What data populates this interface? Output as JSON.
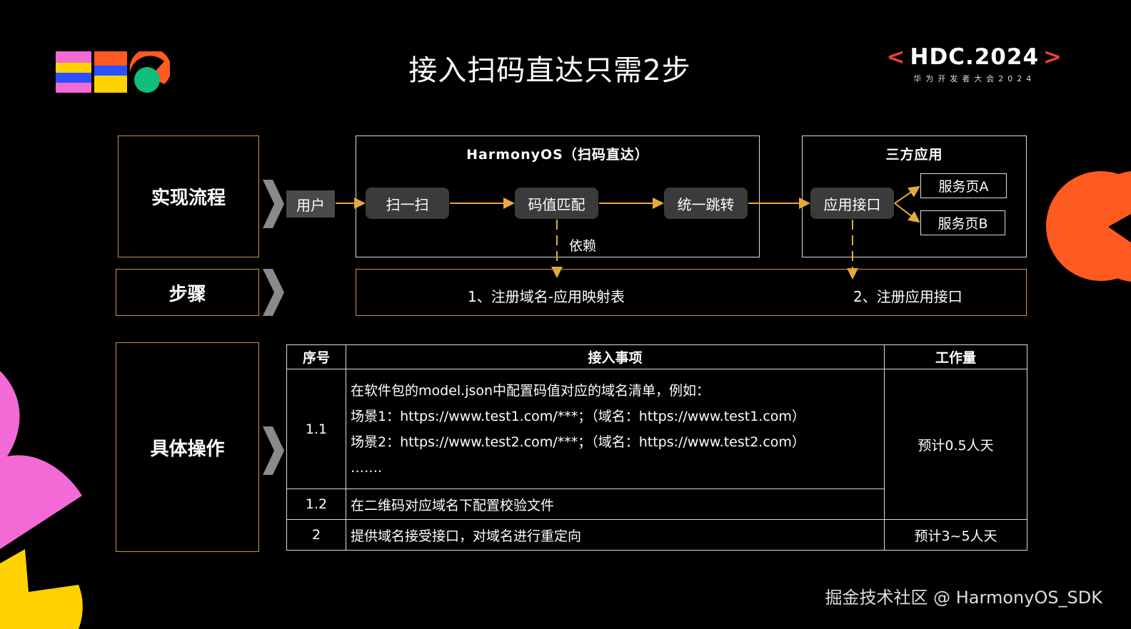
{
  "header": {
    "title": "接入扫码直达只需2步",
    "brand_main": "HDC.2024",
    "brand_lt": "<",
    "brand_gt": ">",
    "brand_sub": "华为开发者大会2024"
  },
  "rows": {
    "flow_label": "实现流程",
    "steps_label": "步骤",
    "ops_label": "具体操作"
  },
  "flow": {
    "user": "用户",
    "harmony_title": "HarmonyOS（扫码直达）",
    "scan": "扫一扫",
    "match": "码值匹配",
    "jump": "统一跳转",
    "depends": "依赖",
    "third_title": "三方应用",
    "app_api": "应用接口",
    "page_a": "服务页A",
    "page_b": "服务页B"
  },
  "steps": {
    "step1": "1、注册域名-应用映射表",
    "step2": "2、注册应用接口"
  },
  "table": {
    "headers": [
      "序号",
      "接入事项",
      "工作量"
    ],
    "rows": [
      {
        "no": "1.1",
        "lines": [
          "在软件包的model.json中配置码值对应的域名清单，例如：",
          "场景1：https://www.test1.com/***；（域名：https://www.test1.com）",
          "场景2：https://www.test2.com/***；（域名：https://www.test2.com）",
          "……."
        ]
      },
      {
        "no": "1.2",
        "item": "在二维码对应域名下配置校验文件"
      },
      {
        "no": "2",
        "item": "提供域名接受接口，对域名进行重定向",
        "effort": "预计3~5人天"
      }
    ],
    "effort_1": "预计0.5人天"
  },
  "footer": "掘金技术社区 @ HarmonyOS_SDK",
  "colors": {
    "background": "#000000",
    "accent_gold": "#c9973e",
    "arrow": "#e8a93a",
    "brand_red": "#e8403c",
    "deco_orange": "#ff5a1f",
    "deco_pink": "#f36ad6",
    "deco_yellow": "#ffd200"
  }
}
